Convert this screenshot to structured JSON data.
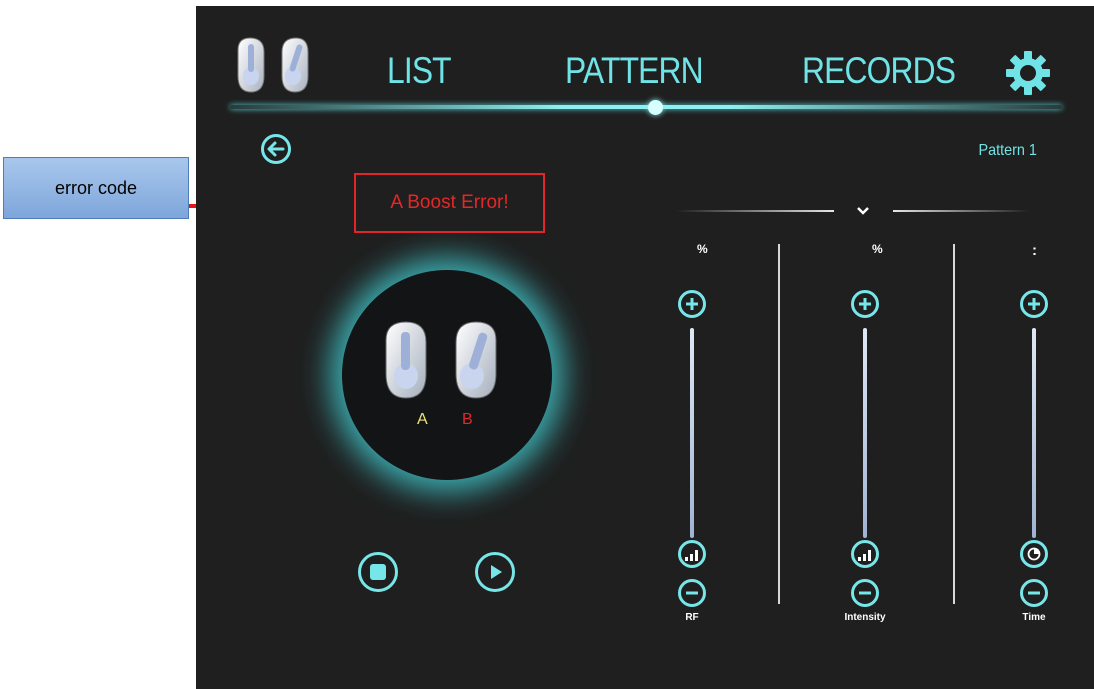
{
  "annotation": {
    "callout_label": "error code",
    "error_message": "A Boost Error!"
  },
  "nav": {
    "tabs": [
      {
        "label": "LIST"
      },
      {
        "label": "PATTERN"
      },
      {
        "label": "RECORDS"
      }
    ],
    "active_tab": "PATTERN"
  },
  "pattern": {
    "name": "Pattern 1"
  },
  "device": {
    "probe_a_label": "A",
    "probe_b_label": "B",
    "probe_a_color": "#f0e27a",
    "probe_b_color": "#e0282d"
  },
  "sliders": [
    {
      "title": "RF",
      "unit": "%",
      "icon": "signal-bars-icon"
    },
    {
      "title": "Intensity",
      "unit": "%",
      "icon": "signal-bars-icon"
    },
    {
      "title": "Time",
      "unit": ":",
      "icon": "clock-icon"
    }
  ],
  "colors": {
    "accent": "#6fe3e6",
    "background": "#1f1f1f",
    "error": "#e62727"
  }
}
